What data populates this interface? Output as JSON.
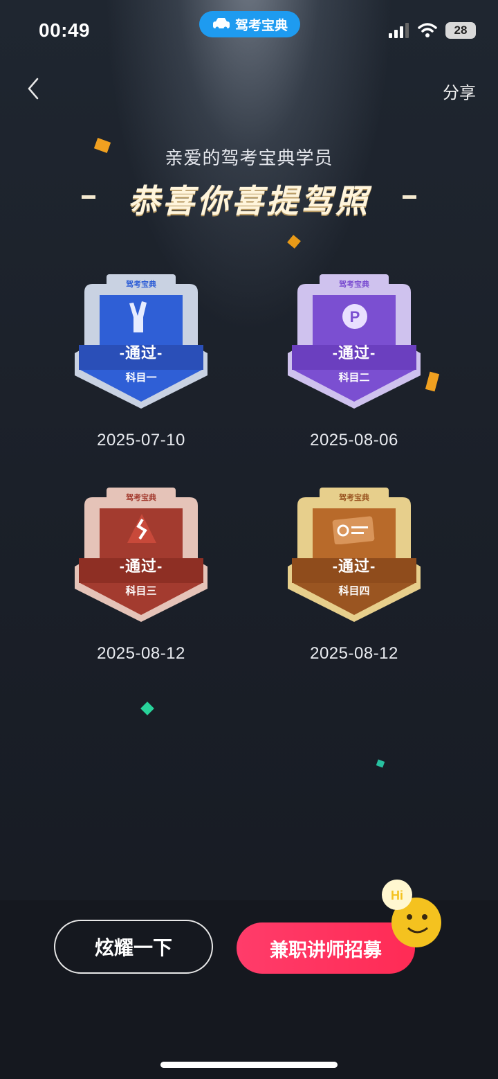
{
  "status_bar": {
    "time": "00:49",
    "app_name": "驾考宝典",
    "battery": "28"
  },
  "nav": {
    "back_icon": "chevron-left-icon",
    "share_label": "分享"
  },
  "hero": {
    "subtitle": "亲爱的驾考宝典学员",
    "headline": "恭喜你喜提驾照"
  },
  "badges": [
    {
      "brand": "驾考宝典",
      "pass": "-通过-",
      "subject": "科目一",
      "date": "2025-07-10",
      "color": "#2f5fd6",
      "icon": "victory-hand-icon"
    },
    {
      "brand": "驾考宝典",
      "pass": "-通过-",
      "subject": "科目二",
      "date": "2025-08-06",
      "color": "#7b4fd1",
      "icon": "parking-icon"
    },
    {
      "brand": "驾考宝典",
      "pass": "-通过-",
      "subject": "科目三",
      "date": "2025-08-12",
      "color": "#a33b2f",
      "icon": "winding-road-icon"
    },
    {
      "brand": "驾考宝典",
      "pass": "-通过-",
      "subject": "科目四",
      "date": "2025-08-12",
      "color": "#9a5521",
      "icon": "license-card-icon"
    }
  ],
  "actions": {
    "show_off_label": "炫耀一下",
    "recruit_label": "兼职讲师招募"
  },
  "colors": {
    "accent_pink": "#ff2b55",
    "app_blue": "#1e9bf0",
    "gold_text": "#fff5dc"
  }
}
